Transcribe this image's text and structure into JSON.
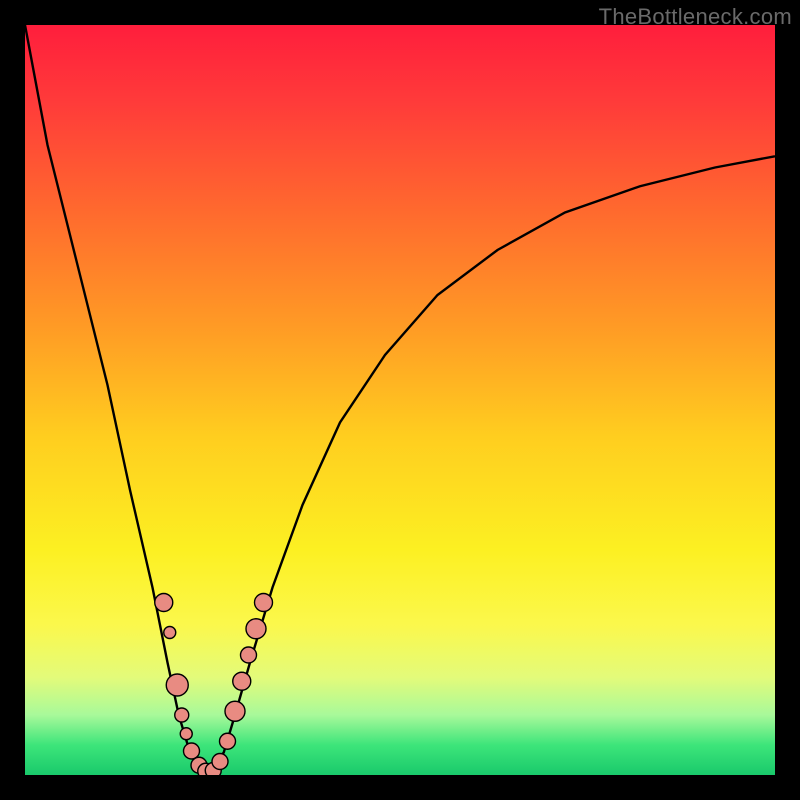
{
  "watermark_text": "TheBottleneck.com",
  "chart_data": {
    "type": "line",
    "title": "",
    "xlabel": "",
    "ylabel": "",
    "xlim": [
      0,
      100
    ],
    "ylim": [
      0,
      100
    ],
    "grid": false,
    "series": [
      {
        "name": "curve",
        "scale_note": "x and y as percentage of inner plot area (0-100). y=0 is bottom, y=100 is top.",
        "x": [
          0,
          3,
          7,
          11,
          14,
          17,
          19,
          20.5,
          22,
          23,
          24,
          25,
          26.5,
          28,
          30,
          33,
          37,
          42,
          48,
          55,
          63,
          72,
          82,
          92,
          100
        ],
        "y": [
          100,
          84,
          68,
          52,
          38,
          25,
          15,
          8,
          3,
          1,
          0,
          1,
          3,
          8,
          15,
          25,
          36,
          47,
          56,
          64,
          70,
          75,
          78.5,
          81,
          82.5
        ]
      }
    ],
    "markers": {
      "name": "highlight-dots",
      "scale_note": "x, y in percent of inner plot area; r is radius in px",
      "points": [
        {
          "x": 18.5,
          "y": 23,
          "r": 9
        },
        {
          "x": 19.3,
          "y": 19,
          "r": 6
        },
        {
          "x": 20.3,
          "y": 12,
          "r": 11
        },
        {
          "x": 20.9,
          "y": 8,
          "r": 7
        },
        {
          "x": 21.5,
          "y": 5.5,
          "r": 6
        },
        {
          "x": 22.2,
          "y": 3.2,
          "r": 8
        },
        {
          "x": 23.2,
          "y": 1.3,
          "r": 8
        },
        {
          "x": 24.1,
          "y": 0.5,
          "r": 8
        },
        {
          "x": 25.1,
          "y": 0.6,
          "r": 8
        },
        {
          "x": 26.0,
          "y": 1.8,
          "r": 8
        },
        {
          "x": 27.0,
          "y": 4.5,
          "r": 8
        },
        {
          "x": 28.0,
          "y": 8.5,
          "r": 10
        },
        {
          "x": 28.9,
          "y": 12.5,
          "r": 9
        },
        {
          "x": 29.8,
          "y": 16,
          "r": 8
        },
        {
          "x": 30.8,
          "y": 19.5,
          "r": 10
        },
        {
          "x": 31.8,
          "y": 23,
          "r": 9
        }
      ]
    },
    "annotations": [],
    "legend": {
      "visible": false
    }
  },
  "colors": {
    "curve_stroke": "#000000",
    "marker_fill": "#e88b82",
    "marker_stroke": "#000000",
    "frame_border": "#000000"
  }
}
